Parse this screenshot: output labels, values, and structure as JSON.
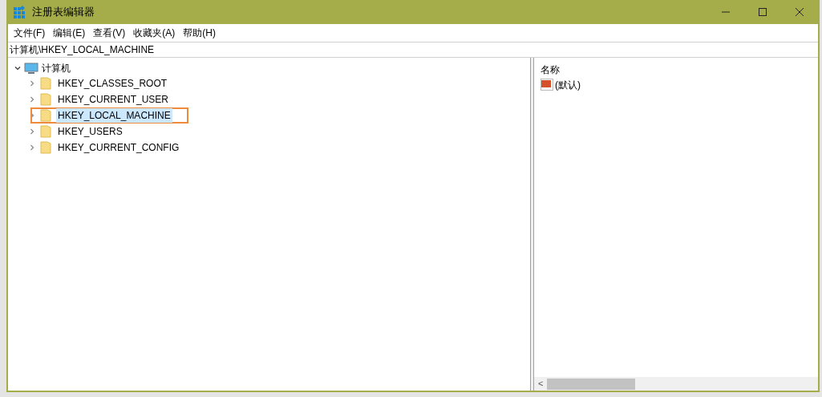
{
  "window": {
    "title": "注册表编辑器"
  },
  "menu": [
    {
      "label": "文件(F)"
    },
    {
      "label": "编辑(E)"
    },
    {
      "label": "查看(V)"
    },
    {
      "label": "收藏夹(A)"
    },
    {
      "label": "帮助(H)"
    }
  ],
  "address": "计算机\\HKEY_LOCAL_MACHINE",
  "tree": {
    "label": "计算机",
    "expanded": true,
    "children": [
      {
        "label": "HKEY_CLASSES_ROOT",
        "selected": false,
        "expanded": false,
        "highlighted": false
      },
      {
        "label": "HKEY_CURRENT_USER",
        "selected": false,
        "expanded": false,
        "highlighted": false
      },
      {
        "label": "HKEY_LOCAL_MACHINE",
        "selected": true,
        "expanded": false,
        "highlighted": true
      },
      {
        "label": "HKEY_USERS",
        "selected": false,
        "expanded": false,
        "highlighted": false
      },
      {
        "label": "HKEY_CURRENT_CONFIG",
        "selected": false,
        "expanded": false,
        "highlighted": false
      }
    ]
  },
  "values": {
    "columns": [
      "名称"
    ],
    "rows": [
      {
        "name": "(默认)"
      }
    ]
  },
  "scrollbar": {
    "left_arrow": "<"
  }
}
